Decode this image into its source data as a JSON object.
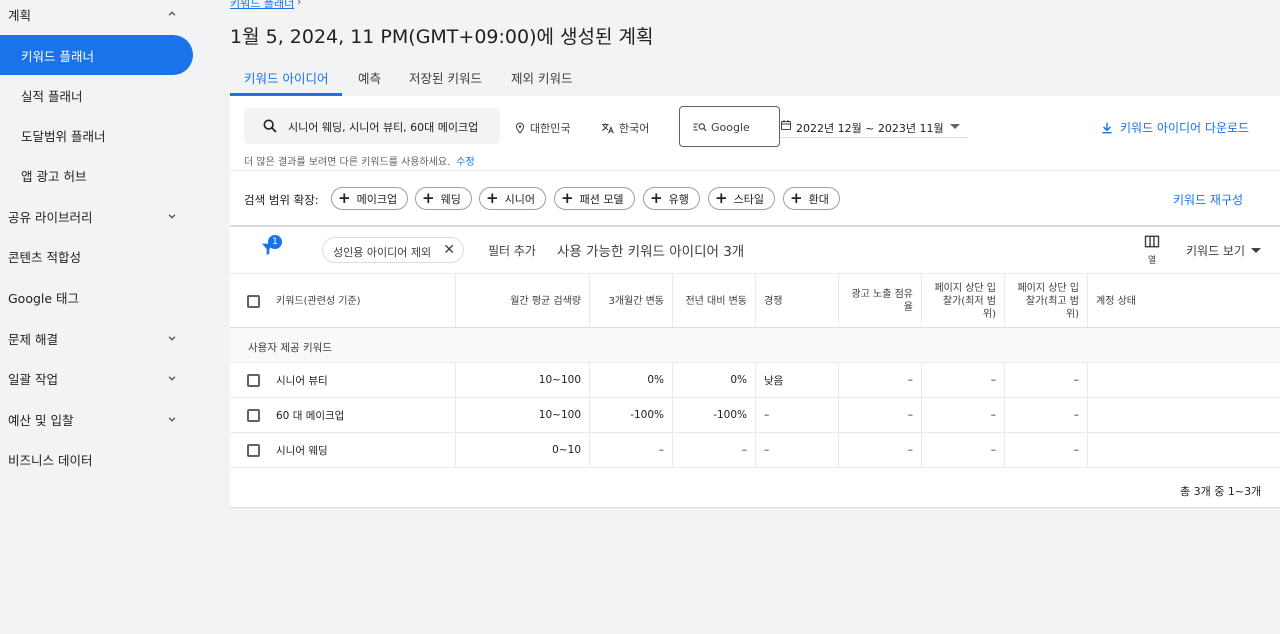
{
  "sidebar": {
    "items": [
      {
        "label": "계획",
        "chevron": "up"
      },
      {
        "label": "키워드 플래너",
        "active": true
      },
      {
        "label": "실적 플래너"
      },
      {
        "label": "도달범위 플래너"
      },
      {
        "label": "앱 광고 허브"
      },
      {
        "label": "공유 라이브러리",
        "chevron": "down"
      },
      {
        "label": "콘텐츠 적합성"
      },
      {
        "label": "Google 태그"
      },
      {
        "label": "문제 해결",
        "chevron": "down"
      },
      {
        "label": "일괄 작업",
        "chevron": "down"
      },
      {
        "label": "예산 및 입찰",
        "chevron": "down"
      },
      {
        "label": "비즈니스 데이터"
      }
    ]
  },
  "header": {
    "breadcrumb": "키워드 플래너",
    "breadcrumb_sep": "›",
    "title": "1월 5, 2024, 11 PM(GMT+09:00)에 생성된 계획"
  },
  "tabs": [
    {
      "label": "키워드 아이디어",
      "active": true
    },
    {
      "label": "예측"
    },
    {
      "label": "저장된 키워드"
    },
    {
      "label": "제외 키워드"
    }
  ],
  "toolbar": {
    "search_value": "시니어 웨딩, 시니어 뷰티, 60대 메이크업",
    "location": "대한민국",
    "language": "한국어",
    "engine": "Google",
    "date_range": "2022년 12월 ~ 2023년 11월",
    "download_label": "키워드 아이디어 다운로드",
    "hint": "더 많은 결과를 보려면 다른 키워드를 사용하세요.",
    "hint_link": "수정"
  },
  "expand": {
    "label": "검색 범위 확장:",
    "chips": [
      "메이크업",
      "웨딩",
      "시니어",
      "패션 모델",
      "유행",
      "스타일",
      "환대"
    ],
    "refine_label": "키워드 재구성"
  },
  "filters": {
    "badge": "1",
    "active_filter": "성인용 아이디어 제외",
    "add_filter": "필터 추가",
    "count_text": "사용 가능한 키워드 아이디어 3개",
    "columns_label": "열",
    "view_label": "키워드 보기"
  },
  "table": {
    "headers": [
      "키워드(관련성 기준)",
      "월간 평균 검색량",
      "3개월간 변동",
      "전년 대비 변동",
      "경쟁",
      "광고 노출 점유율",
      "페이지 상단 입찰가(최저 범위)",
      "페이지 상단 입찰가(최고 범위)",
      "계정 상태"
    ],
    "group_label": "사용자 제공 키워드",
    "rows": [
      {
        "keyword": "시니어 뷰티",
        "volume": "10~100",
        "three_month": "0%",
        "yoy": "0%",
        "competition": "낮음",
        "impression": "–",
        "bid_low": "–",
        "bid_high": "–",
        "status": ""
      },
      {
        "keyword": "60 대 메이크업",
        "volume": "10~100",
        "three_month": "-100%",
        "yoy": "-100%",
        "competition": "–",
        "impression": "–",
        "bid_low": "–",
        "bid_high": "–",
        "status": ""
      },
      {
        "keyword": "시니어 웨딩",
        "volume": "0~10",
        "three_month": "–",
        "yoy": "–",
        "competition": "–",
        "impression": "–",
        "bid_low": "–",
        "bid_high": "–",
        "status": ""
      }
    ],
    "footer": "총 3개 중 1~3개"
  },
  "colors": {
    "accent": "#1a73e8",
    "background": "#f1f3f4",
    "card": "#ffffff"
  }
}
